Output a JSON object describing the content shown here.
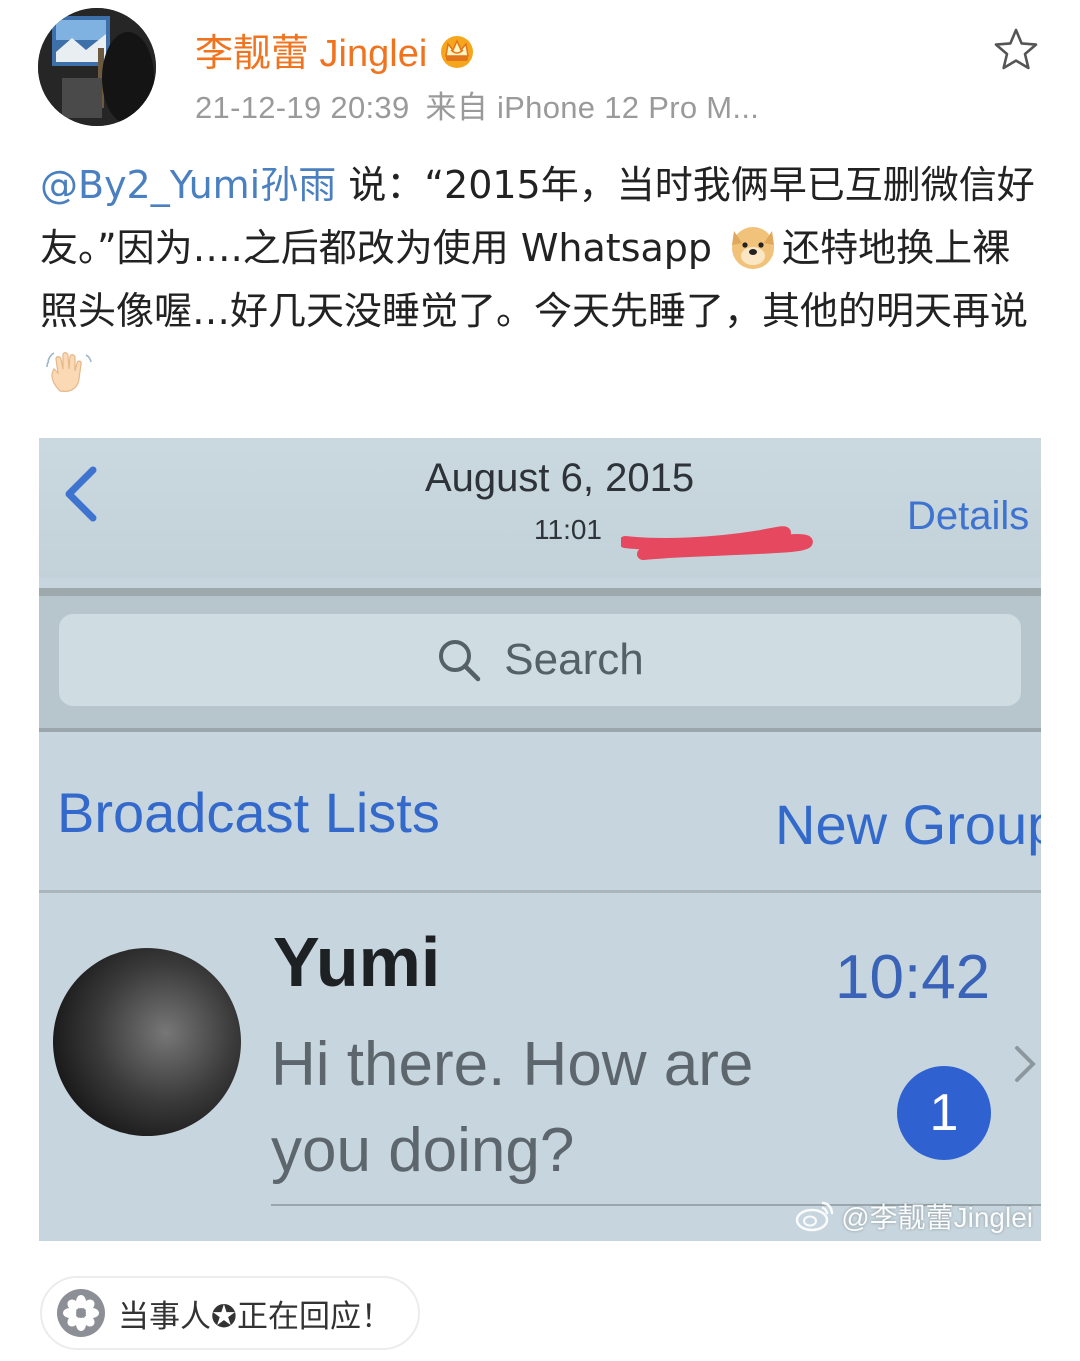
{
  "header": {
    "author_name": "李靓蕾 Jinglei",
    "timestamp": "21-12-19 20:39",
    "source": "来自 iPhone 12 Pro M..."
  },
  "post": {
    "mention": "@By2_Yumi孙雨",
    "text_part1": " 说：“2015年，当时我俩早已互删微信好友。”因为….之后都改为使用 Whatsapp",
    "text_part2": "还特地换上裸照头像喔…好几天没睡觉了。今天先睡了，其他的明天再说"
  },
  "photo": {
    "date": "August 6, 2015",
    "time": "11:01",
    "details_label": "Details",
    "search_placeholder": "Search",
    "broadcast_label": "Broadcast Lists",
    "new_group_label": "New Group",
    "chat": {
      "name": "Yumi",
      "time": "10:42",
      "message": "Hi there. How are you doing?",
      "unread_count": "1"
    },
    "watermark": "@李靓蕾Jinglei"
  },
  "topic": {
    "label": "当事人✪正在回应！"
  },
  "icons": {
    "crown": "crown-icon",
    "star": "star-icon",
    "doge_emoji": "doge-emoji-icon",
    "wave_emoji": "waving-hand-icon",
    "topic": "topic-flower-icon"
  },
  "colors": {
    "author": "#f0741f",
    "mention": "#4a7fc0",
    "meta": "#9a9a9a",
    "ios_blue": "#3469cc"
  }
}
